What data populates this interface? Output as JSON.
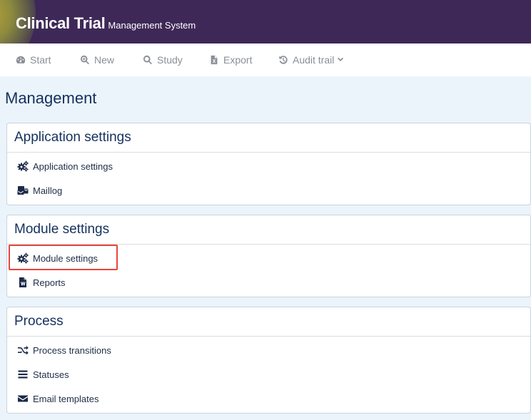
{
  "brand": {
    "title": "Clinical Trial",
    "subtitle": "Management System"
  },
  "nav": {
    "start": "Start",
    "new": "New",
    "study": "Study",
    "export": "Export",
    "audit_trail": "Audit trail"
  },
  "page": {
    "title": "Management"
  },
  "sections": {
    "application": {
      "title": "Application settings",
      "items": {
        "app_settings": "Application settings",
        "maillog": "Maillog"
      }
    },
    "module": {
      "title": "Module settings",
      "items": {
        "module_settings": "Module settings",
        "reports": "Reports"
      }
    },
    "process": {
      "title": "Process",
      "items": {
        "process_transitions": "Process transitions",
        "statuses": "Statuses",
        "email_templates": "Email templates"
      }
    }
  },
  "colors": {
    "brand_bg": "#3e2857",
    "content_bg": "#ecf4fb",
    "heading": "#14315e",
    "nav_text": "#8a8f96",
    "highlight": "#e8453c"
  },
  "icons": {
    "start": "dashboard-gauge-icon",
    "new": "search-plus-icon",
    "study": "search-icon",
    "export": "file-excel-icon",
    "audit_trail": "history-icon",
    "settings": "cogs-icon",
    "maillog": "mail-bulk-icon",
    "reports": "file-word-icon",
    "process_transitions": "random-shuffle-icon",
    "statuses": "list-bars-icon",
    "email_templates": "envelope-icon"
  }
}
